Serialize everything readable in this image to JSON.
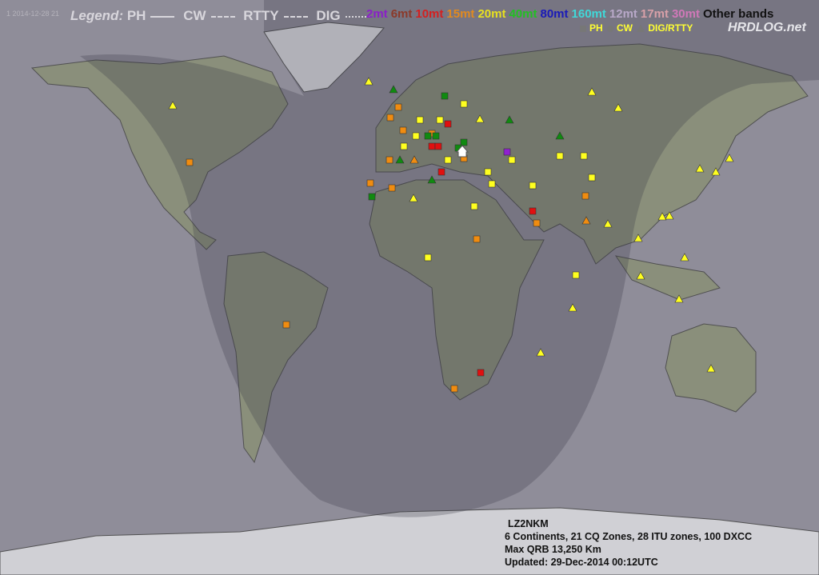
{
  "timestamp": "1 2014-12-28 21",
  "legend": {
    "label": "Legend:",
    "modes": [
      "PH",
      "CW",
      "RTTY",
      "DIG"
    ]
  },
  "bands": [
    {
      "label": "2mt",
      "color": "#8a1fc8"
    },
    {
      "label": "6mt",
      "color": "#8b3a2a"
    },
    {
      "label": "10mt",
      "color": "#d42020"
    },
    {
      "label": "15mt",
      "color": "#e08a20"
    },
    {
      "label": "20mt",
      "color": "#e8e020"
    },
    {
      "label": "40mt",
      "color": "#22c022"
    },
    {
      "label": "80mt",
      "color": "#1a1ab8"
    },
    {
      "label": "160mt",
      "color": "#40d8d8"
    },
    {
      "label": "12mt",
      "color": "#b8a8c8"
    },
    {
      "label": "17mt",
      "color": "#d8a0a8"
    },
    {
      "label": "30mt",
      "color": "#d078b8"
    },
    {
      "label": "Other bands",
      "color": "#111111"
    }
  ],
  "mode_key": {
    "ph": "PH",
    "cw": "CW",
    "dig": "DIG/RTTY"
  },
  "brand": "HRDLOG.net",
  "stats": {
    "callsign": "LZ2NKM",
    "summary": "6 Continents, 21 CQ Zones, 28 ITU zones, 100 DXCC",
    "max_qrb": "Max QRB 13,250 Km",
    "updated": "Updated: 29-Dec-2014 00:12UTC"
  },
  "home": {
    "lon": 23.2,
    "lat": 42
  },
  "colors": {
    "orange": "#f08c10",
    "yellow": "#ffff20",
    "red": "#e01010",
    "green": "#108a10",
    "purple": "#9020d0"
  },
  "markers": [
    {
      "s": "sq",
      "c": "orange",
      "p": [
        [
          237,
          203
        ],
        [
          488,
          147
        ],
        [
          498,
          134
        ],
        [
          463,
          229
        ],
        [
          490,
          235
        ],
        [
          504,
          163
        ],
        [
          580,
          198
        ],
        [
          596,
          299
        ],
        [
          568,
          486
        ],
        [
          732,
          245
        ],
        [
          671,
          279
        ],
        [
          358,
          406
        ],
        [
          487,
          200
        ],
        [
          540,
          167
        ]
      ]
    },
    {
      "s": "sq",
      "c": "yellow",
      "p": [
        [
          535,
          322
        ],
        [
          593,
          258
        ],
        [
          720,
          344
        ],
        [
          666,
          232
        ],
        [
          615,
          230
        ],
        [
          505,
          183
        ],
        [
          525,
          150
        ],
        [
          550,
          150
        ],
        [
          580,
          130
        ],
        [
          610,
          215
        ],
        [
          640,
          200
        ],
        [
          700,
          195
        ],
        [
          730,
          195
        ],
        [
          740,
          222
        ],
        [
          560,
          200
        ],
        [
          520,
          170
        ]
      ]
    },
    {
      "s": "sq",
      "c": "red",
      "p": [
        [
          666,
          264
        ],
        [
          601,
          466
        ],
        [
          552,
          215
        ],
        [
          540,
          183
        ],
        [
          548,
          183
        ],
        [
          560,
          155
        ]
      ]
    },
    {
      "s": "sq",
      "c": "green",
      "p": [
        [
          465,
          246
        ],
        [
          556,
          120
        ],
        [
          535,
          170
        ],
        [
          580,
          178
        ],
        [
          573,
          185
        ],
        [
          545,
          170
        ]
      ]
    },
    {
      "s": "sq",
      "c": "purple",
      "p": [
        [
          634,
          190
        ]
      ]
    },
    {
      "s": "tri",
      "c": "yellow",
      "p": [
        [
          216,
          132
        ],
        [
          461,
          102
        ],
        [
          517,
          248
        ],
        [
          716,
          385
        ],
        [
          676,
          441
        ],
        [
          889,
          461
        ],
        [
          798,
          298
        ],
        [
          828,
          271
        ],
        [
          837,
          270
        ],
        [
          801,
          345
        ],
        [
          849,
          374
        ],
        [
          856,
          322
        ],
        [
          875,
          211
        ],
        [
          895,
          215
        ],
        [
          912,
          198
        ],
        [
          773,
          135
        ],
        [
          760,
          280
        ],
        [
          600,
          149
        ],
        [
          740,
          115
        ]
      ]
    },
    {
      "s": "tri",
      "c": "green",
      "p": [
        [
          492,
          112
        ],
        [
          637,
          150
        ],
        [
          700,
          170
        ],
        [
          500,
          200
        ],
        [
          540,
          225
        ]
      ]
    },
    {
      "s": "tri",
      "c": "orange",
      "p": [
        [
          733,
          276
        ],
        [
          518,
          200
        ]
      ]
    }
  ]
}
